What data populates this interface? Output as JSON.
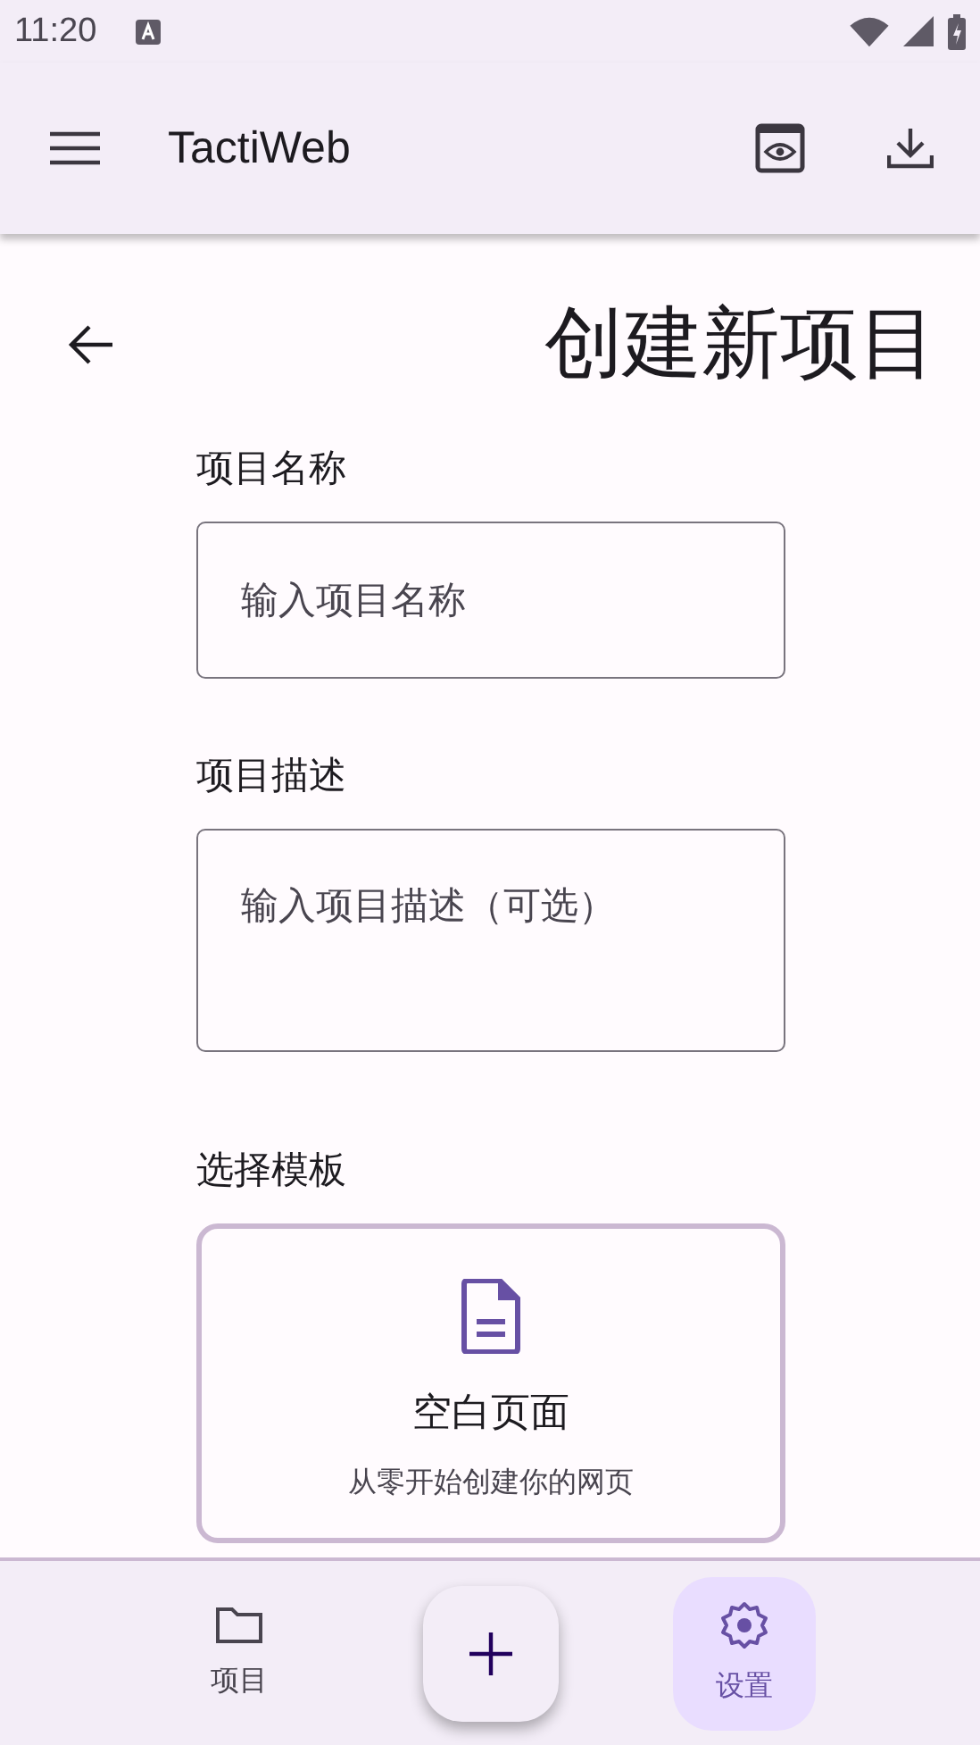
{
  "status_bar": {
    "time": "11:20"
  },
  "app_bar": {
    "title": "TactiWeb"
  },
  "page_title": "创建新项目",
  "fields": [
    {
      "kind": "input",
      "label": "项目名称",
      "placeholder": "输入项目名称"
    },
    {
      "kind": "textarea",
      "label": "项目描述",
      "placeholder": "输入项目描述（可选）"
    }
  ],
  "template_section": {
    "label": "选择模板",
    "templates": [
      {
        "title": "空白页面",
        "description": "从零开始创建你的网页"
      }
    ]
  },
  "bottom_nav": {
    "items": [
      {
        "kind": "projects",
        "label": "项目",
        "selected": false
      },
      {
        "kind": "settings",
        "label": "设置",
        "selected": true
      }
    ]
  }
}
